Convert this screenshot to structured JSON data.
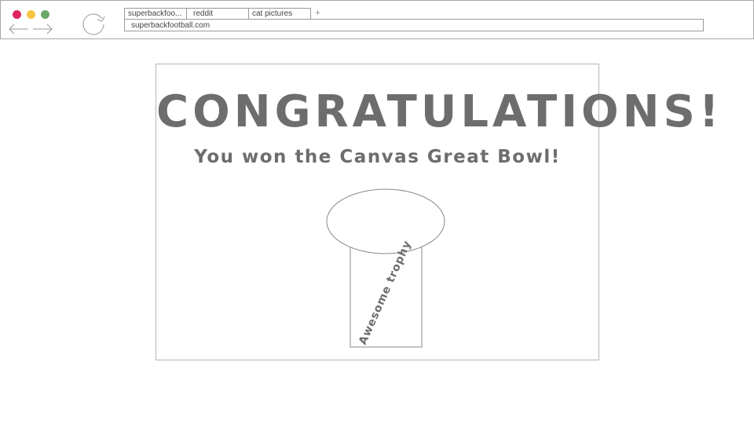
{
  "browser": {
    "tabs": [
      {
        "label": "superbackfoo..."
      },
      {
        "label": "reddit"
      },
      {
        "label": "cat pictures"
      }
    ],
    "new_tab_symbol": "+",
    "address": "superbackfootball.com",
    "traffic_lights": {
      "close": "#e0245e",
      "minimize": "#f5c542",
      "maximize": "#6aa86a"
    }
  },
  "page": {
    "headline": "CONGRATULATIONS!",
    "subheadline": "You won the Canvas Great Bowl!",
    "trophy_label": "Awesome trophy"
  }
}
